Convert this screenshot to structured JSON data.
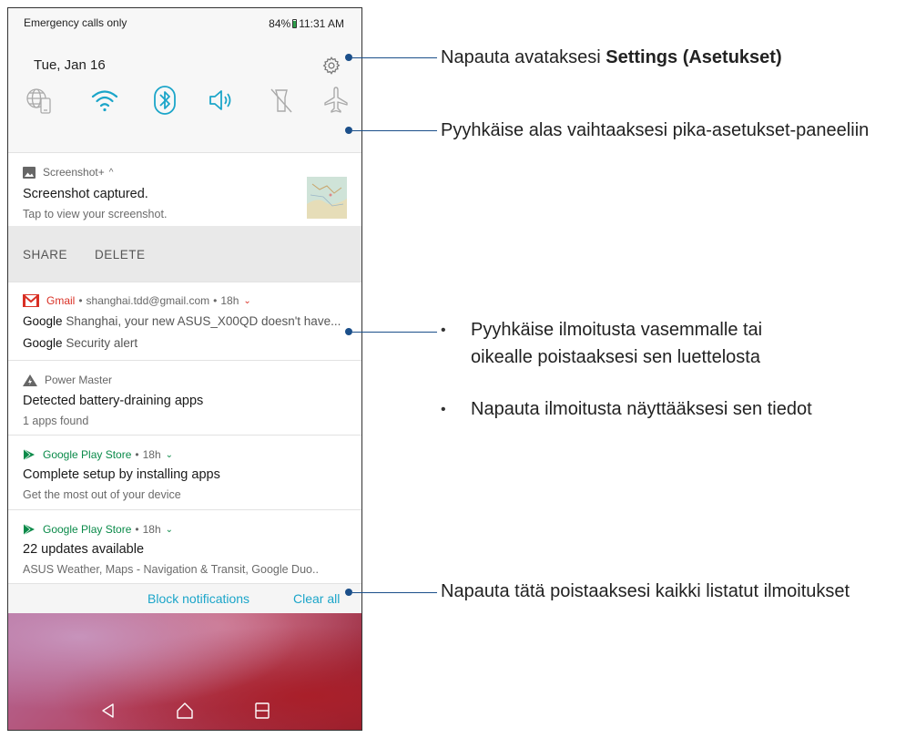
{
  "status_bar": {
    "carrier_text": "Emergency calls only",
    "battery_percent": "84%",
    "time": "11:31 AM"
  },
  "quick_settings": {
    "date": "Tue, Jan 16",
    "icons": [
      "globe-phone-icon",
      "wifi-icon",
      "bluetooth-icon",
      "volume-icon",
      "flashlight-off-icon",
      "airplane-mode-icon"
    ]
  },
  "notifications": {
    "screenshot": {
      "app_name": "Screenshot+",
      "title": "Screenshot captured.",
      "text": "Tap to view your screenshot.",
      "actions": [
        "SHARE",
        "DELETE"
      ]
    },
    "gmail": {
      "app_name": "Gmail",
      "account": "shanghai.tdd@gmail.com",
      "age": "18h",
      "line1_sender": "Google",
      "line1_text": "Shanghai, your new ASUS_X00QD doesn't have...",
      "line2_sender": "Google",
      "line2_text": "Security alert"
    },
    "power_master": {
      "app_name": "Power Master",
      "title": "Detected battery-draining apps",
      "text": "1 apps found"
    },
    "play_store_1": {
      "app_name": "Google Play Store",
      "age": "18h",
      "title": "Complete setup by installing apps",
      "text": "Get the most out of your device"
    },
    "play_store_2": {
      "app_name": "Google Play Store",
      "age": "18h",
      "title": "22 updates available",
      "text": "ASUS Weather, Maps - Navigation & Transit, Google Duo.."
    }
  },
  "footer": {
    "block_label": "Block notifications",
    "clear_label": "Clear all"
  },
  "callouts": {
    "settings_prefix": "Napauta avataksesi ",
    "settings_bold": "Settings (Asetukset)",
    "swipe_down": "Pyyhkäise alas vaihtaaksesi pika-asetukset-paneeliin",
    "bullet_swipe_line1": "Pyyhkäise ilmoitusta vasemmalle tai",
    "bullet_swipe_line2": "oikealle poistaaksesi sen luettelosta",
    "bullet_tap": "Napauta ilmoitusta näyttääksesi sen tiedot",
    "clear_all": "Napauta tätä poistaaksesi kaikki listatut ilmoitukset"
  },
  "colors": {
    "accent_blue": "#1ba5c9",
    "callout_line": "#1b4f8a",
    "gmail_red": "#d93025",
    "play_green": "#0a8a49"
  }
}
